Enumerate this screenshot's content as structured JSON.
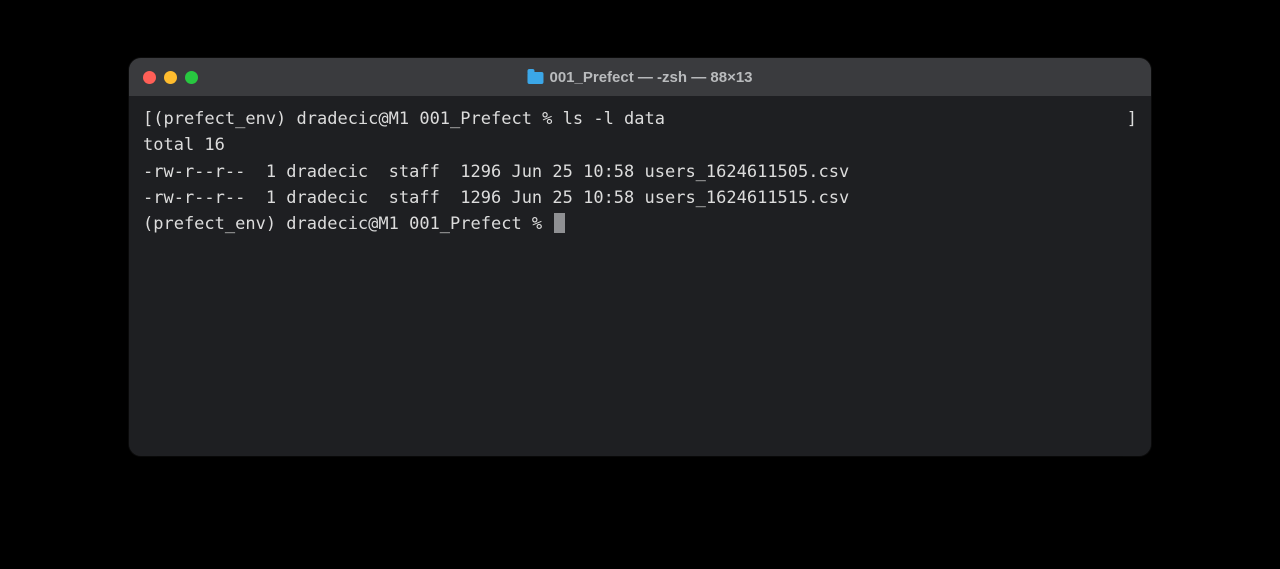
{
  "window": {
    "title": "001_Prefect — -zsh — 88×13"
  },
  "terminal": {
    "line1_left": "[(prefect_env) dradecic@M1 001_Prefect % ls -l data",
    "line1_right": "]",
    "line2": "total 16",
    "line3": "-rw-r--r--  1 dradecic  staff  1296 Jun 25 10:58 users_1624611505.csv",
    "line4": "-rw-r--r--  1 dradecic  staff  1296 Jun 25 10:58 users_1624611515.csv",
    "line5": "(prefect_env) dradecic@M1 001_Prefect % "
  }
}
